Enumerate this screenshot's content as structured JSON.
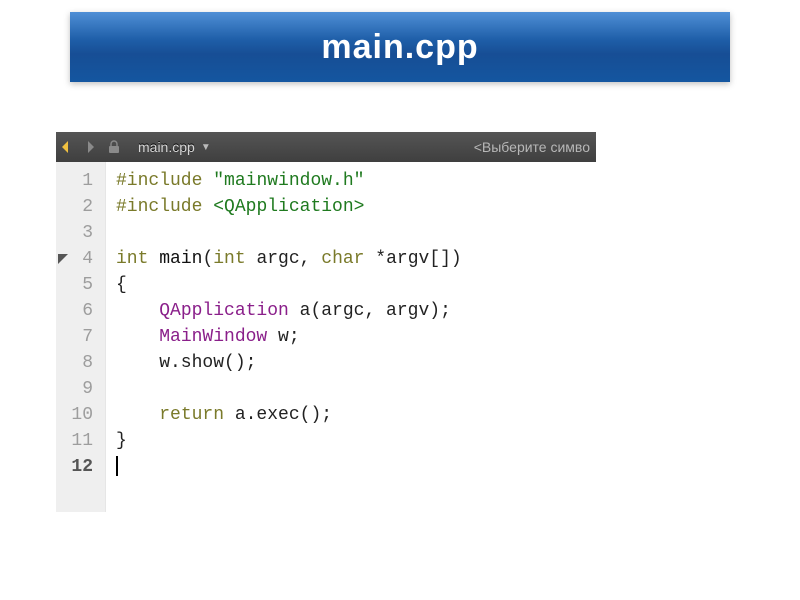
{
  "banner": {
    "title": "main.cpp"
  },
  "toolbar": {
    "filename": "main.cpp",
    "symbol_placeholder": "<Выберите симво"
  },
  "gutter": {
    "lines": [
      "1",
      "2",
      "3",
      "4",
      "5",
      "6",
      "7",
      "8",
      "9",
      "10",
      "11",
      "12"
    ],
    "side_mark_line": 4,
    "current_line": 12
  },
  "code": {
    "l1": {
      "kw": "#include",
      "target": "\"mainwindow.h\""
    },
    "l2": {
      "kw": "#include",
      "target": "<QApplication>"
    },
    "l4": {
      "kw1": "int",
      "name": "main",
      "p1": "(",
      "kw2": "int",
      "a1": " argc, ",
      "kw3": "char",
      "a2": " *argv[])"
    },
    "l5": "{",
    "l6": {
      "indent": "    ",
      "type": "QApplication",
      "rest": " a(argc, argv);"
    },
    "l7": {
      "indent": "    ",
      "type": "MainWindow",
      "rest": " w;"
    },
    "l8": "    w.show();",
    "l10": {
      "indent": "    ",
      "kw": "return",
      "rest": " a.exec();"
    },
    "l11": "}"
  }
}
